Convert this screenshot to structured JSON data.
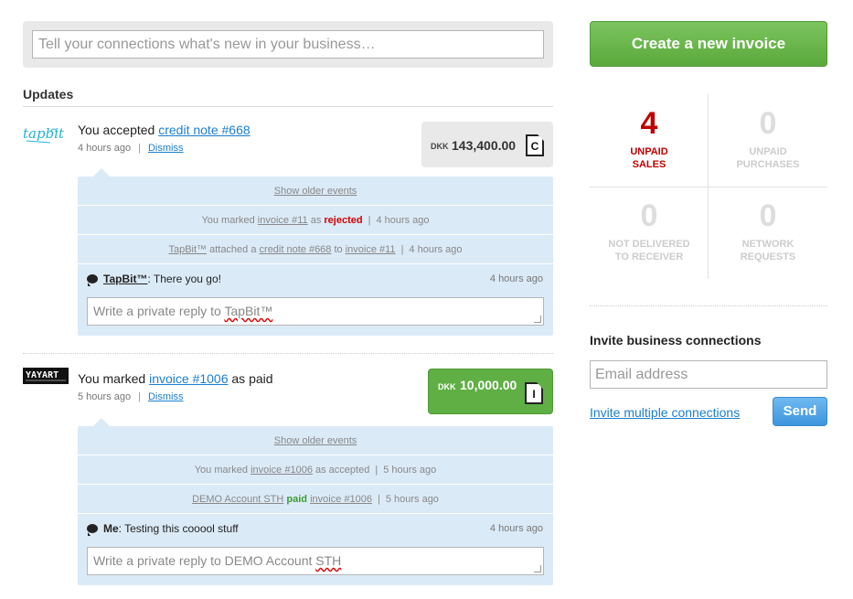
{
  "status": {
    "placeholder": "Tell your connections what's new in your business…"
  },
  "updates": {
    "title": "Updates",
    "items": [
      {
        "headline_prefix": "You accepted ",
        "headline_link": "credit note #668",
        "time": "4 hours ago",
        "dismiss": "Dismiss",
        "currency": "DKK",
        "amount": "143,400.00",
        "doc_letter": "C",
        "card_color": "#e9e9e9",
        "thread": {
          "show_older": "Show older events",
          "event1": {
            "prefix": "You marked ",
            "link": "invoice #11",
            "mid": " as ",
            "status": "rejected",
            "time": "4 hours ago"
          },
          "event2": {
            "actor": "TapBit™",
            "mid1": " attached a ",
            "link1": "credit note #668",
            "mid2": " to ",
            "link2": "invoice #11",
            "time": "4 hours ago"
          },
          "comment": {
            "author": "TapBit™",
            "text": ": There you go!",
            "time": "4 hours ago"
          },
          "reply_prefix": "Write a private reply to ",
          "reply_target": "TapBit™"
        }
      },
      {
        "headline_prefix": "You marked ",
        "headline_link": "invoice #1006",
        "headline_suffix": " as paid",
        "time": "5 hours ago",
        "dismiss": "Dismiss",
        "currency": "DKK",
        "amount": "10,000.00",
        "doc_letter": "I",
        "card_color": "#5faf45",
        "thread": {
          "show_older": "Show older events",
          "event1": {
            "prefix": "You marked ",
            "link": "invoice #1006",
            "suffix": " as accepted",
            "time": "5 hours ago"
          },
          "event2": {
            "actor": "DEMO Account STH",
            "status": "paid",
            "link": "invoice #1006",
            "time": "5 hours ago"
          },
          "comment": {
            "author": "Me",
            "text": ": Testing this cooool stuff",
            "time": "4 hours ago"
          },
          "reply_prefix": "Write a private reply to DEMO Account ",
          "reply_target": "STH"
        }
      }
    ]
  },
  "sidebar": {
    "create_invoice": "Create a new invoice",
    "stats": [
      {
        "num": "4",
        "line1": "UNPAID",
        "line2": "SALES",
        "active": true
      },
      {
        "num": "0",
        "line1": "UNPAID",
        "line2": "PURCHASES",
        "active": false
      },
      {
        "num": "0",
        "line1": "NOT DELIVERED",
        "line2": "TO RECEIVER",
        "active": false
      },
      {
        "num": "0",
        "line1": "NETWORK",
        "line2": "REQUESTS",
        "active": false
      }
    ],
    "active_color": "#c00000",
    "invite": {
      "title": "Invite business connections",
      "email_placeholder": "Email address",
      "multi_link": "Invite multiple connections",
      "send": "Send"
    }
  }
}
